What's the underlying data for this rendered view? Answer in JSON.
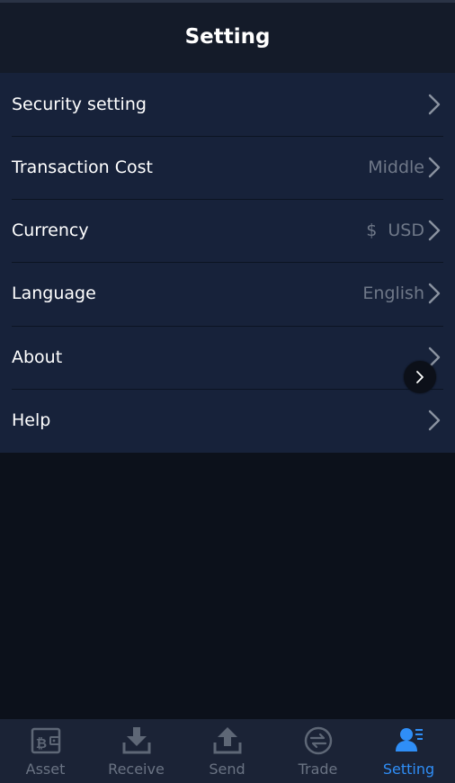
{
  "header": {
    "title": "Setting"
  },
  "settings": {
    "items": [
      {
        "label": "Security setting",
        "value": ""
      },
      {
        "label": "Transaction Cost",
        "value": "Middle"
      },
      {
        "label": "Currency",
        "value": "$  USD"
      },
      {
        "label": "Language",
        "value": "English"
      },
      {
        "label": "About",
        "value": ""
      },
      {
        "label": "Help",
        "value": ""
      }
    ]
  },
  "floating_button": {
    "icon": "chevron-right-icon"
  },
  "tabbar": {
    "tabs": [
      {
        "label": "Asset",
        "icon": "wallet-bitcoin-icon",
        "active": false
      },
      {
        "label": "Receive",
        "icon": "download-tray-icon",
        "active": false
      },
      {
        "label": "Send",
        "icon": "upload-tray-icon",
        "active": false
      },
      {
        "label": "Trade",
        "icon": "exchange-arrows-icon",
        "active": false
      },
      {
        "label": "Setting",
        "icon": "user-list-icon",
        "active": true
      }
    ]
  },
  "colors": {
    "background": "#0c111b",
    "header_bg": "#141b29",
    "list_bg": "#17223a",
    "tabbar_bg": "#1b2336",
    "accent": "#2f8ef7",
    "muted_text": "#6f7888"
  }
}
